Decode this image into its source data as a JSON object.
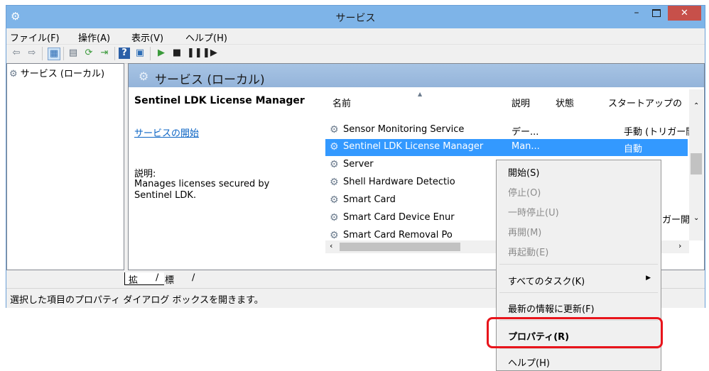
{
  "window": {
    "title": "サービス"
  },
  "menubar": {
    "items": [
      "ファイル(F)",
      "操作(A)",
      "表示(V)",
      "ヘルプ(H)"
    ]
  },
  "tree": {
    "root": "サービス (ローカル)"
  },
  "content": {
    "header": "サービス (ローカル)",
    "detail": {
      "name": "Sentinel LDK License Manager",
      "start_link": "サービスの開始",
      "desc_label": "説明:",
      "desc_text": "Manages licenses secured by Sentinel LDK."
    },
    "columns": [
      "名前",
      "説明",
      "状態",
      "スタートアップの"
    ],
    "rows": [
      {
        "name": "Sensor Monitoring Service",
        "desc": "デー...",
        "status": "",
        "startup": "手動 (トリガー開"
      },
      {
        "name": "Sentinel LDK License Manager",
        "desc": "Man...",
        "status": "",
        "startup": "自動"
      },
      {
        "name": "Server",
        "desc": "",
        "status": "",
        "startup": ""
      },
      {
        "name": "Shell Hardware Detectio",
        "desc": "",
        "status": "",
        "startup": ""
      },
      {
        "name": "Smart Card",
        "desc": "",
        "status": "",
        "startup": ""
      },
      {
        "name": "Smart Card Device Enur",
        "desc": "",
        "status": "",
        "startup": "トリガー開"
      },
      {
        "name": "Smart Card Removal Po",
        "desc": "",
        "status": "",
        "startup": ""
      }
    ]
  },
  "tabs": [
    "拡張",
    "標準"
  ],
  "status": {
    "text": "選択した項目のプロパティ ダイアログ ボックスを開きます。"
  },
  "context_menu": {
    "start": "開始(S)",
    "stop": "停止(O)",
    "pause": "一時停止(U)",
    "resume": "再開(M)",
    "restart": "再起動(E)",
    "all_tasks": "すべてのタスク(K)",
    "refresh": "最新の情報に更新(F)",
    "properties": "プロパティ(R)",
    "help": "ヘルプ(H)"
  },
  "colors": {
    "accent": "#3399ff",
    "highlight": "#e8141b",
    "titlebar": "#7eb4e8",
    "close": "#c7504a"
  }
}
